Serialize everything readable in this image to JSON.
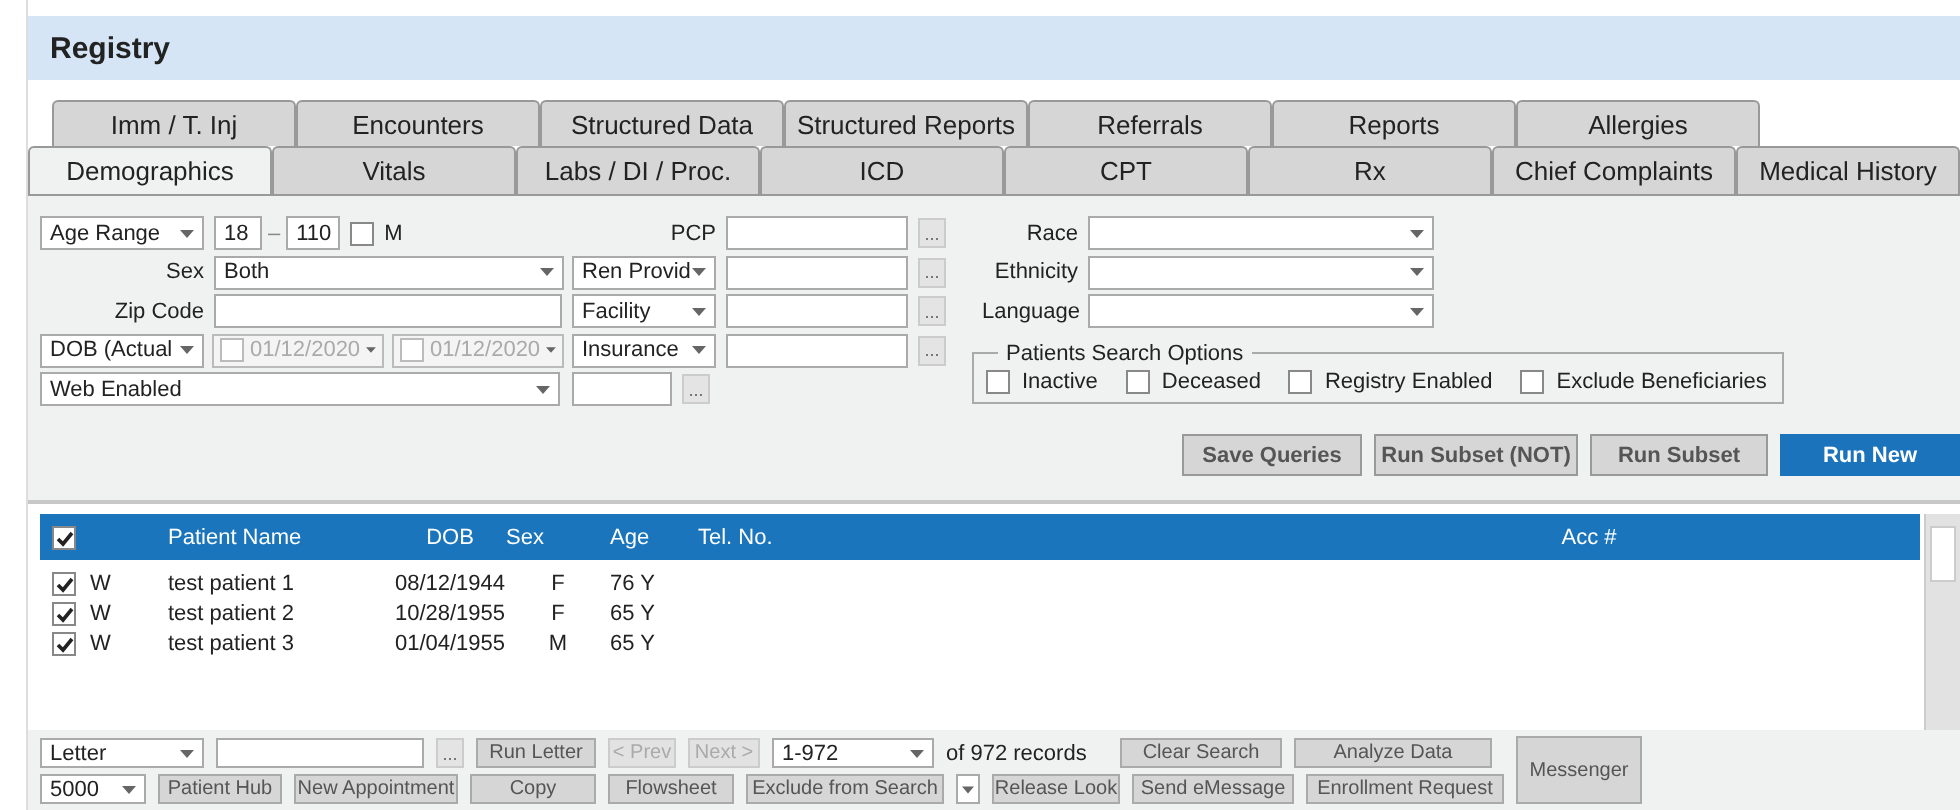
{
  "window": {
    "title": "Registry"
  },
  "tabs_row_1": [
    {
      "label": "Imm / T. Inj",
      "selected": false
    },
    {
      "label": "Encounters",
      "selected": false
    },
    {
      "label": "Structured Data",
      "selected": false
    },
    {
      "label": "Structured Reports",
      "selected": false
    },
    {
      "label": "Referrals",
      "selected": false
    },
    {
      "label": "Reports",
      "selected": false
    },
    {
      "label": "Allergies",
      "selected": false
    }
  ],
  "tabs_row_2": [
    {
      "label": "Demographics",
      "selected": true
    },
    {
      "label": "Vitals",
      "selected": false
    },
    {
      "label": "Labs / DI / Proc.",
      "selected": false
    },
    {
      "label": "ICD",
      "selected": false
    },
    {
      "label": "CPT",
      "selected": false
    },
    {
      "label": "Rx",
      "selected": false
    },
    {
      "label": "Chief Complaints",
      "selected": false
    },
    {
      "label": "Medical History",
      "selected": false
    }
  ],
  "filters": {
    "age": {
      "mode": "Age Range",
      "from": "18",
      "separator": "–",
      "to": "110",
      "months_label": "M",
      "months_checked": false
    },
    "sex": {
      "label": "Sex",
      "value": "Both"
    },
    "zip": {
      "label": "Zip Code"
    },
    "dob": {
      "mode": "DOB (Actual",
      "from": {
        "date": "01/12/2020",
        "checked": false
      },
      "to": {
        "date": "01/12/2020",
        "checked": false
      }
    },
    "web": {
      "value": "Web Enabled"
    },
    "providers": [
      {
        "kind": "label",
        "label": "PCP",
        "more": "..."
      },
      {
        "kind": "select",
        "label": "Ren Provid",
        "more": "..."
      },
      {
        "kind": "select",
        "label": "Facility",
        "more": "..."
      },
      {
        "kind": "select",
        "label": "Insurance",
        "more": "..."
      },
      {
        "kind": "short",
        "more": "..."
      }
    ],
    "demographics": [
      {
        "label": "Race"
      },
      {
        "label": "Ethnicity"
      },
      {
        "label": "Language"
      }
    ],
    "search_options": {
      "title": "Patients Search Options",
      "options": [
        {
          "label": "Inactive",
          "checked": false
        },
        {
          "label": "Deceased",
          "checked": false
        },
        {
          "label": "Registry Enabled",
          "checked": false
        },
        {
          "label": "Exclude Beneficiaries",
          "checked": false
        }
      ]
    }
  },
  "actions": [
    {
      "label": "Save Queries",
      "primary": false
    },
    {
      "label": "Run Subset (NOT)",
      "primary": false
    },
    {
      "label": "Run Subset",
      "primary": false
    },
    {
      "label": "Run New",
      "primary": true
    }
  ],
  "table": {
    "header_checked": true,
    "columns": [
      "",
      "Patient Name",
      "DOB",
      "Sex",
      "Age",
      "Tel. No.",
      "Acc #"
    ],
    "rows": [
      {
        "checked": true,
        "cells": [
          "W",
          "test patient 1",
          "08/12/1944",
          "F",
          "76 Y"
        ]
      },
      {
        "checked": true,
        "cells": [
          "W",
          "test patient 2",
          "10/28/1955",
          "F",
          "65 Y"
        ]
      },
      {
        "checked": true,
        "cells": [
          "W",
          "test patient 3",
          "01/04/1955",
          "M",
          "65 Y"
        ]
      }
    ]
  },
  "toolbar": {
    "row_1": [
      {
        "kind": "select",
        "label": "Letter"
      },
      {
        "kind": "input"
      },
      {
        "kind": "more",
        "label": "..."
      },
      {
        "kind": "button",
        "label": "Run Letter",
        "disabled": false
      },
      {
        "kind": "button",
        "label": "< Prev",
        "disabled": true
      },
      {
        "kind": "button",
        "label": "Next >",
        "disabled": true
      },
      {
        "kind": "select",
        "label": "1-972"
      },
      {
        "kind": "text",
        "label": "of 972 records"
      },
      {
        "kind": "button",
        "label": "Clear Search",
        "disabled": false
      },
      {
        "kind": "button",
        "label": "Analyze Data",
        "disabled": false
      }
    ],
    "row_2": [
      {
        "kind": "select",
        "label": "5000"
      },
      {
        "kind": "button",
        "label": "Patient Hub",
        "disabled": false
      },
      {
        "kind": "button",
        "label": "New Appointment",
        "disabled": false
      },
      {
        "kind": "button",
        "label": "Copy",
        "disabled": false
      },
      {
        "kind": "button",
        "label": "Flowsheet",
        "disabled": false
      },
      {
        "kind": "button",
        "label": "Exclude from Search",
        "disabled": false
      },
      {
        "kind": "caret"
      },
      {
        "kind": "button",
        "label": "Release Look",
        "disabled": false
      },
      {
        "kind": "button",
        "label": "Send eMessage",
        "disabled": false
      },
      {
        "kind": "button",
        "label": "Enrollment Request",
        "disabled": false
      }
    ],
    "side_button": {
      "label": "Messenger",
      "disabled": false
    }
  }
}
